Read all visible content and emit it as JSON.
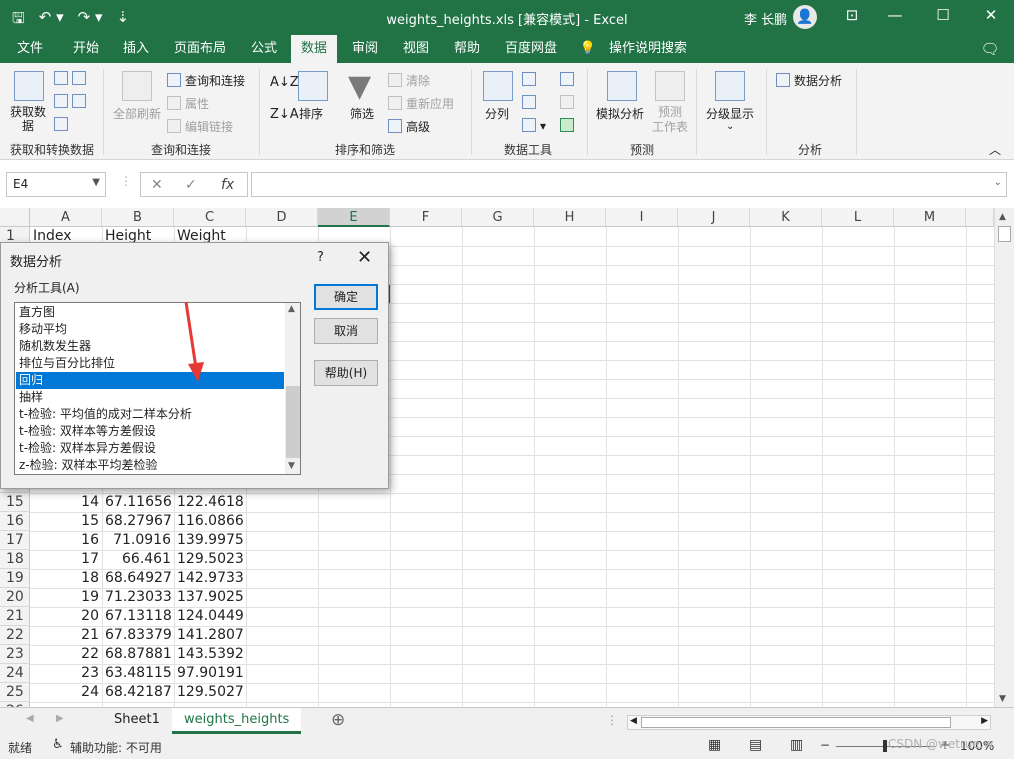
{
  "titlebar": {
    "title": "weights_heights.xls  [兼容模式]  -  Excel",
    "user": "李 长鹏",
    "qat_icons": [
      "save-icon",
      "undo-icon",
      "redo-icon",
      "customize-icon"
    ]
  },
  "ribbon_tabs": [
    "文件",
    "开始",
    "插入",
    "页面布局",
    "公式",
    "数据",
    "审阅",
    "视图",
    "帮助",
    "百度网盘",
    "操作说明搜索"
  ],
  "active_tab": "数据",
  "ribbon": {
    "get_data": "获取数\n据",
    "group1_label": "获取和转换数据",
    "refresh_all": "全部刷新",
    "query_connect": "查询和连接",
    "properties": "属性",
    "edit_links": "编辑链接",
    "group2_label": "查询和连接",
    "sort": "排序",
    "filter": "筛选",
    "clear": "清除",
    "reapply": "重新应用",
    "advanced": "高级",
    "group3_label": "排序和筛选",
    "text_to_columns": "分列",
    "group4_label": "数据工具",
    "what_if": "模拟分析",
    "forecast_sheet": "预测\n工作表",
    "group5_label": "预测",
    "outline": "分级显示",
    "data_analysis": "数据分析",
    "group6_label": "分析"
  },
  "formula_bar": {
    "name_box": "E4",
    "fx": "fx",
    "formula": ""
  },
  "columns": [
    "A",
    "B",
    "C",
    "D",
    "E",
    "F",
    "G",
    "H",
    "I",
    "J",
    "K",
    "L",
    "M"
  ],
  "selected_column": "E",
  "header_row": {
    "row": "1",
    "a": "Index",
    "b": "Height",
    "c": "Weight"
  },
  "rows": [
    {
      "row": "15",
      "a": "14",
      "b": "67.11656",
      "c": "122.4618"
    },
    {
      "row": "16",
      "a": "15",
      "b": "68.27967",
      "c": "116.0866"
    },
    {
      "row": "17",
      "a": "16",
      "b": "71.0916",
      "c": "139.9975"
    },
    {
      "row": "18",
      "a": "17",
      "b": "66.461",
      "c": "129.5023"
    },
    {
      "row": "19",
      "a": "18",
      "b": "68.64927",
      "c": "142.9733"
    },
    {
      "row": "20",
      "a": "19",
      "b": "71.23033",
      "c": "137.9025"
    },
    {
      "row": "21",
      "a": "20",
      "b": "67.13118",
      "c": "124.0449"
    },
    {
      "row": "22",
      "a": "21",
      "b": "67.83379",
      "c": "141.2807"
    },
    {
      "row": "23",
      "a": "22",
      "b": "68.87881",
      "c": "143.5392"
    },
    {
      "row": "24",
      "a": "23",
      "b": "63.48115",
      "c": "97.90191"
    },
    {
      "row": "25",
      "a": "24",
      "b": "68.42187",
      "c": "129.5027"
    }
  ],
  "sheets": {
    "sheet1": "Sheet1",
    "sheet2": "weights_heights"
  },
  "status": {
    "ready": "就绪",
    "accessibility": "辅助功能: 不可用",
    "zoom": "100%",
    "watermark": "CSDN @wetrue.w"
  },
  "dialog": {
    "title": "数据分析",
    "help_mark": "?",
    "close": "✕",
    "list_label": "分析工具(A)",
    "items": [
      "直方图",
      "移动平均",
      "随机数发生器",
      "排位与百分比排位",
      "回归",
      "抽样",
      "t-检验: 平均值的成对二样本分析",
      "t-检验: 双样本等方差假设",
      "t-检验: 双样本异方差假设",
      "z-检验: 双样本平均差检验"
    ],
    "selected_item": "回归",
    "ok": "确定",
    "cancel": "取消",
    "help": "帮助(H)"
  }
}
